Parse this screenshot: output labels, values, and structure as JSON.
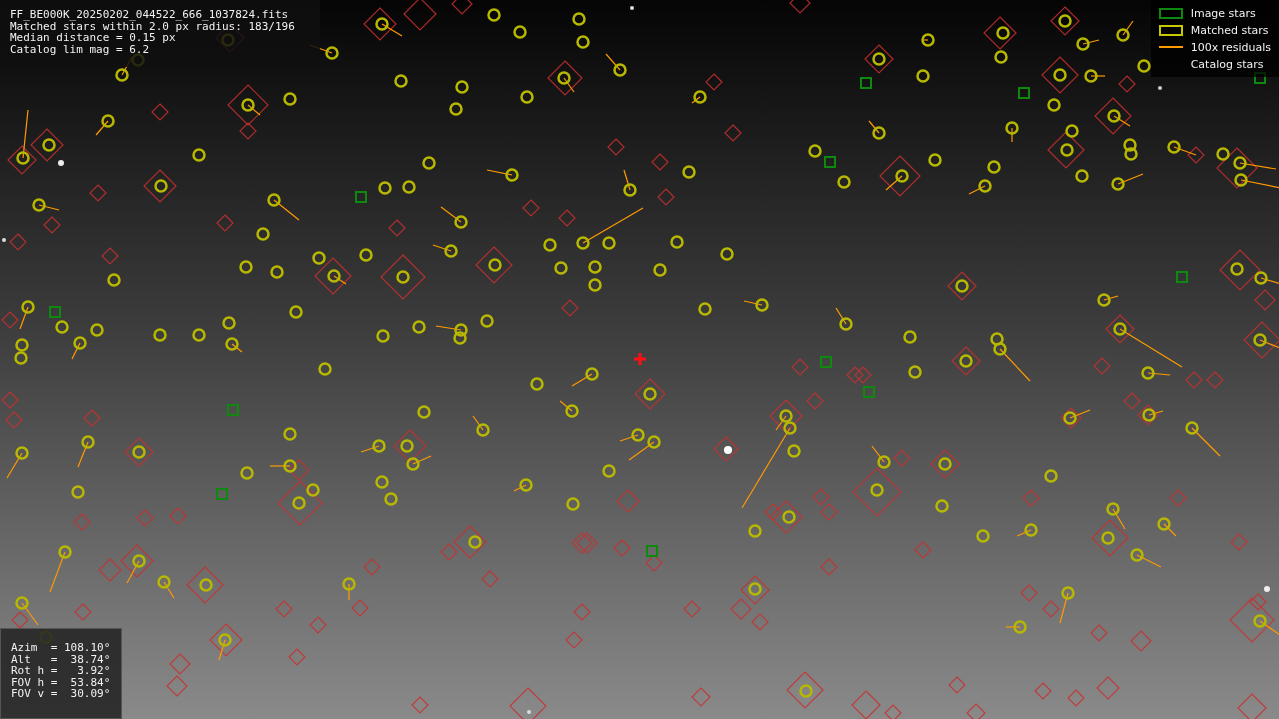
{
  "info_panel": {
    "lines": [
      "FF_BE000K_20250202_044522_666_1037824.fits",
      "Matched stars within 2.0 px radius: 183/196",
      "Median distance = 0.15 px",
      "Catalog lim mag = 6.2"
    ]
  },
  "legend": [
    {
      "label": "Image stars",
      "kind": "box",
      "color": "#0d8a0d"
    },
    {
      "label": "Matched stars",
      "kind": "box",
      "color": "#c8c800"
    },
    {
      "label": "100x residuals",
      "kind": "line",
      "color": "#ff9a00"
    },
    {
      "label": "Catalog stars",
      "kind": "none"
    }
  ],
  "pointing_panel": {
    "lines": [
      "Azim  = 108.10°",
      "Alt   =  38.74°",
      "Rot h =   3.92°",
      "FOV h =  53.84°",
      "FOV v =  30.09°"
    ]
  }
}
